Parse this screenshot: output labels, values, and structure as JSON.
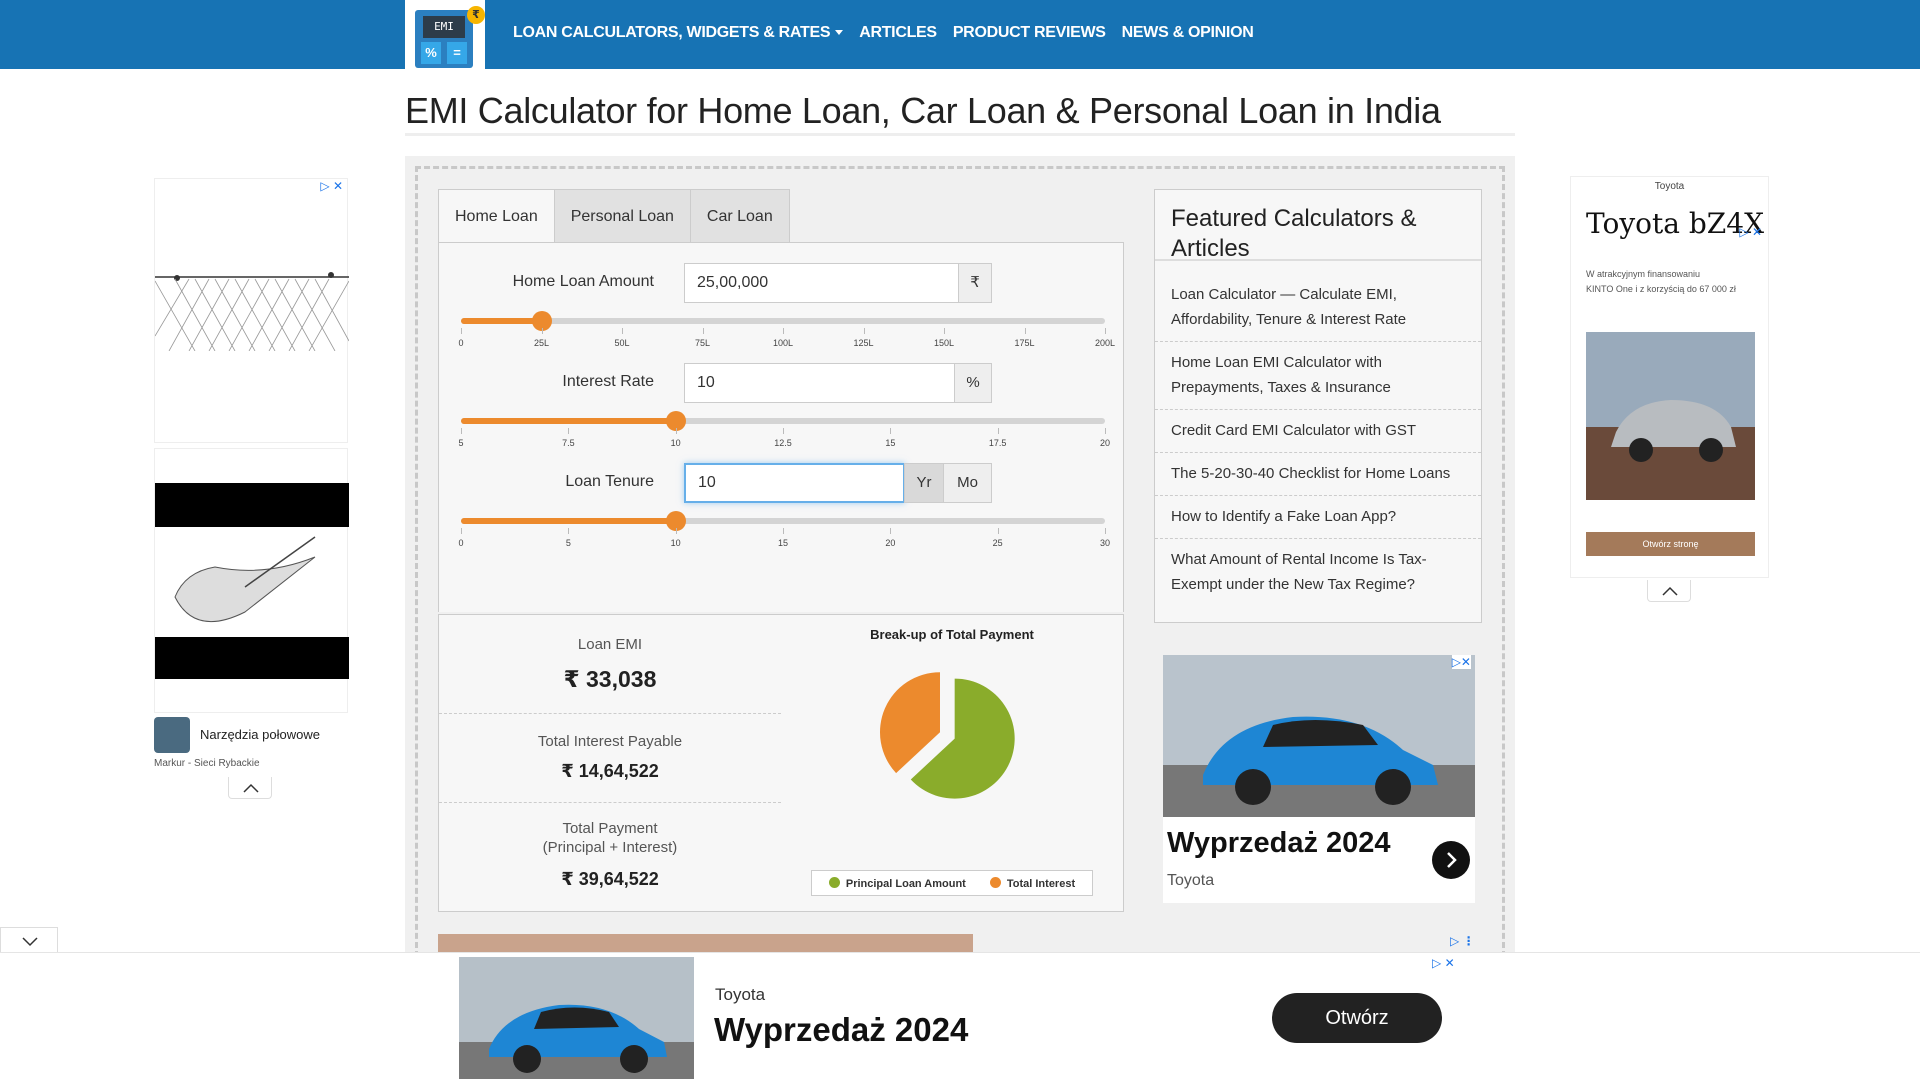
{
  "logo": {
    "screen": "EMI",
    "key1": "%",
    "key2": "=",
    "coin": "₹"
  },
  "nav": {
    "items": [
      "LOAN CALCULATORS, WIDGETS & RATES",
      "ARTICLES",
      "PRODUCT REVIEWS",
      "NEWS & OPINION"
    ]
  },
  "page_title": "EMI Calculator for Home Loan, Car Loan & Personal Loan in India",
  "tabs": [
    "Home Loan",
    "Personal Loan",
    "Car Loan"
  ],
  "form": {
    "amount": {
      "label": "Home Loan Amount",
      "value": "25,00,000",
      "unit": "₹",
      "slider_fraction": 0.125,
      "ticks": [
        "0",
        "25L",
        "50L",
        "75L",
        "100L",
        "125L",
        "150L",
        "175L",
        "200L"
      ]
    },
    "rate": {
      "label": "Interest Rate",
      "value": "10",
      "unit": "%",
      "slider_fraction": 0.3333,
      "ticks": [
        "5",
        "7.5",
        "10",
        "12.5",
        "15",
        "17.5",
        "20"
      ]
    },
    "tenure": {
      "label": "Loan Tenure",
      "value": "10",
      "unit_year": "Yr",
      "unit_month": "Mo",
      "slider_fraction": 0.3333,
      "ticks": [
        "0",
        "5",
        "10",
        "15",
        "20",
        "25",
        "30"
      ]
    }
  },
  "results": {
    "emi_label": "Loan EMI",
    "emi_value": "₹ 33,038",
    "interest_label": "Total Interest Payable",
    "interest_value": "₹ 14,64,522",
    "total_label_1": "Total Payment",
    "total_label_2": "(Principal + Interest)",
    "total_value": "₹ 39,64,522"
  },
  "chart_data": {
    "type": "pie",
    "title": "Break-up of Total Payment",
    "categories": [
      "Principal Loan Amount",
      "Total Interest"
    ],
    "values": [
      2500000,
      1464522
    ],
    "colors": [
      "#8aac2b",
      "#ec8a2d"
    ]
  },
  "featured": {
    "title": "Featured Calculators & Articles",
    "items": [
      [
        "Loan Calculator — Calculate EMI,",
        "Affordability, Tenure & Interest Rate"
      ],
      [
        "Home Loan EMI Calculator with",
        "Prepayments, Taxes & Insurance"
      ],
      [
        "Credit Card EMI Calculator with GST"
      ],
      [
        "The 5-20-30-40 Checklist for Home Loans"
      ],
      [
        "How to Identify a Fake Loan App?"
      ],
      [
        "What Amount of Rental Income Is Tax-",
        "Exempt under the New Tax Regime?"
      ]
    ]
  },
  "ads": {
    "left_title": "Narzędzia połowowe",
    "left_sub": "Markur - Sieci Rybackie",
    "right_brand": "Toyota",
    "right_title": "Toyota bZ4X",
    "right_desc_1": "W atrakcyjnym finansowaniu",
    "right_desc_2": "KINTO One i z korzyścią do 67 000 zł",
    "right_button": "Otwórz stronę",
    "mid_title": "Wyprzedaż 2024",
    "mid_brand": "Toyota",
    "bottom_brand": "Toyota",
    "bottom_title": "Wyprzedaż 2024",
    "bottom_button": "Otwórz"
  }
}
